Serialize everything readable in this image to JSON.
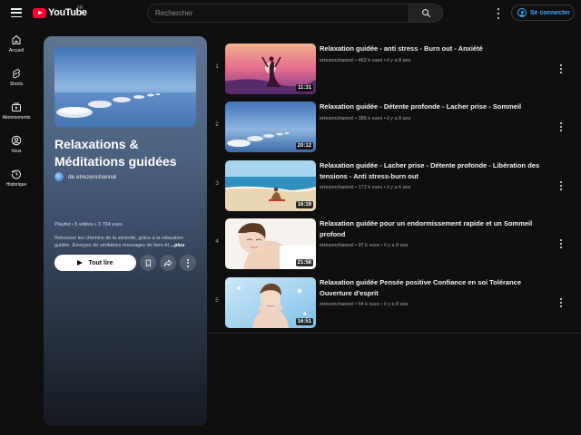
{
  "header": {
    "logo_text": "YouTube",
    "logo_region": "FR",
    "search_placeholder": "Rechercher",
    "signin_label": "Se connecter"
  },
  "sidebar": {
    "items": [
      {
        "label": "Accueil",
        "icon": "home-icon"
      },
      {
        "label": "Shorts",
        "icon": "shorts-icon"
      },
      {
        "label": "Abonnements",
        "icon": "subscriptions-icon"
      },
      {
        "label": "Vous",
        "icon": "you-icon"
      },
      {
        "label": "Historique",
        "icon": "history-icon"
      }
    ]
  },
  "playlist": {
    "title": "Relaxations & Méditations guidées",
    "owner": "de etrezenchannel",
    "meta": "Playlist • 5 vidéos • 3 704 vues",
    "description": "Retrouver les chemins de la sérénité, grâce à la relaxation guidée. Envoyez  de véritables messages de bien-êt",
    "more_label": "...plus",
    "play_label": "Tout lire"
  },
  "videos": [
    {
      "index": "1",
      "title": "Relaxation guidée - anti stress - Burn out - Anxiété",
      "channel": "etrezenchannel",
      "views": "462 k vues",
      "age": "il y a 8 ans",
      "duration": "11:31"
    },
    {
      "index": "2",
      "title": "Relaxation guidée - Détente profonde - Lacher prise - Sommeil",
      "channel": "etrezenchannel",
      "views": "385 k vues",
      "age": "il y a 8 ans",
      "duration": "20:12"
    },
    {
      "index": "3",
      "title": "Relaxation guidée - Lacher prise - Détente profonde - Libération des tensions - Anti stress-burn out",
      "channel": "etrezenchannel",
      "views": "172 k vues",
      "age": "il y a 6 ans",
      "duration": "16:19"
    },
    {
      "index": "4",
      "title": "Relaxation guidée pour un endormissement rapide et un Sommeil profond",
      "channel": "etrezenchannel",
      "views": "97 k vues",
      "age": "il y a 8 ans",
      "duration": "21:58"
    },
    {
      "index": "5",
      "title": "Relaxation guidée Pensée positive Confiance en soi Tolérance Ouverture d'esprit",
      "channel": "etrezenchannel",
      "views": "64 k vues",
      "age": "il y a 8 ans",
      "duration": "16:51"
    }
  ],
  "colors": {
    "background": "#0f0f0f",
    "accent_blue": "#3ea6ff",
    "brand_red": "#ff0033"
  }
}
